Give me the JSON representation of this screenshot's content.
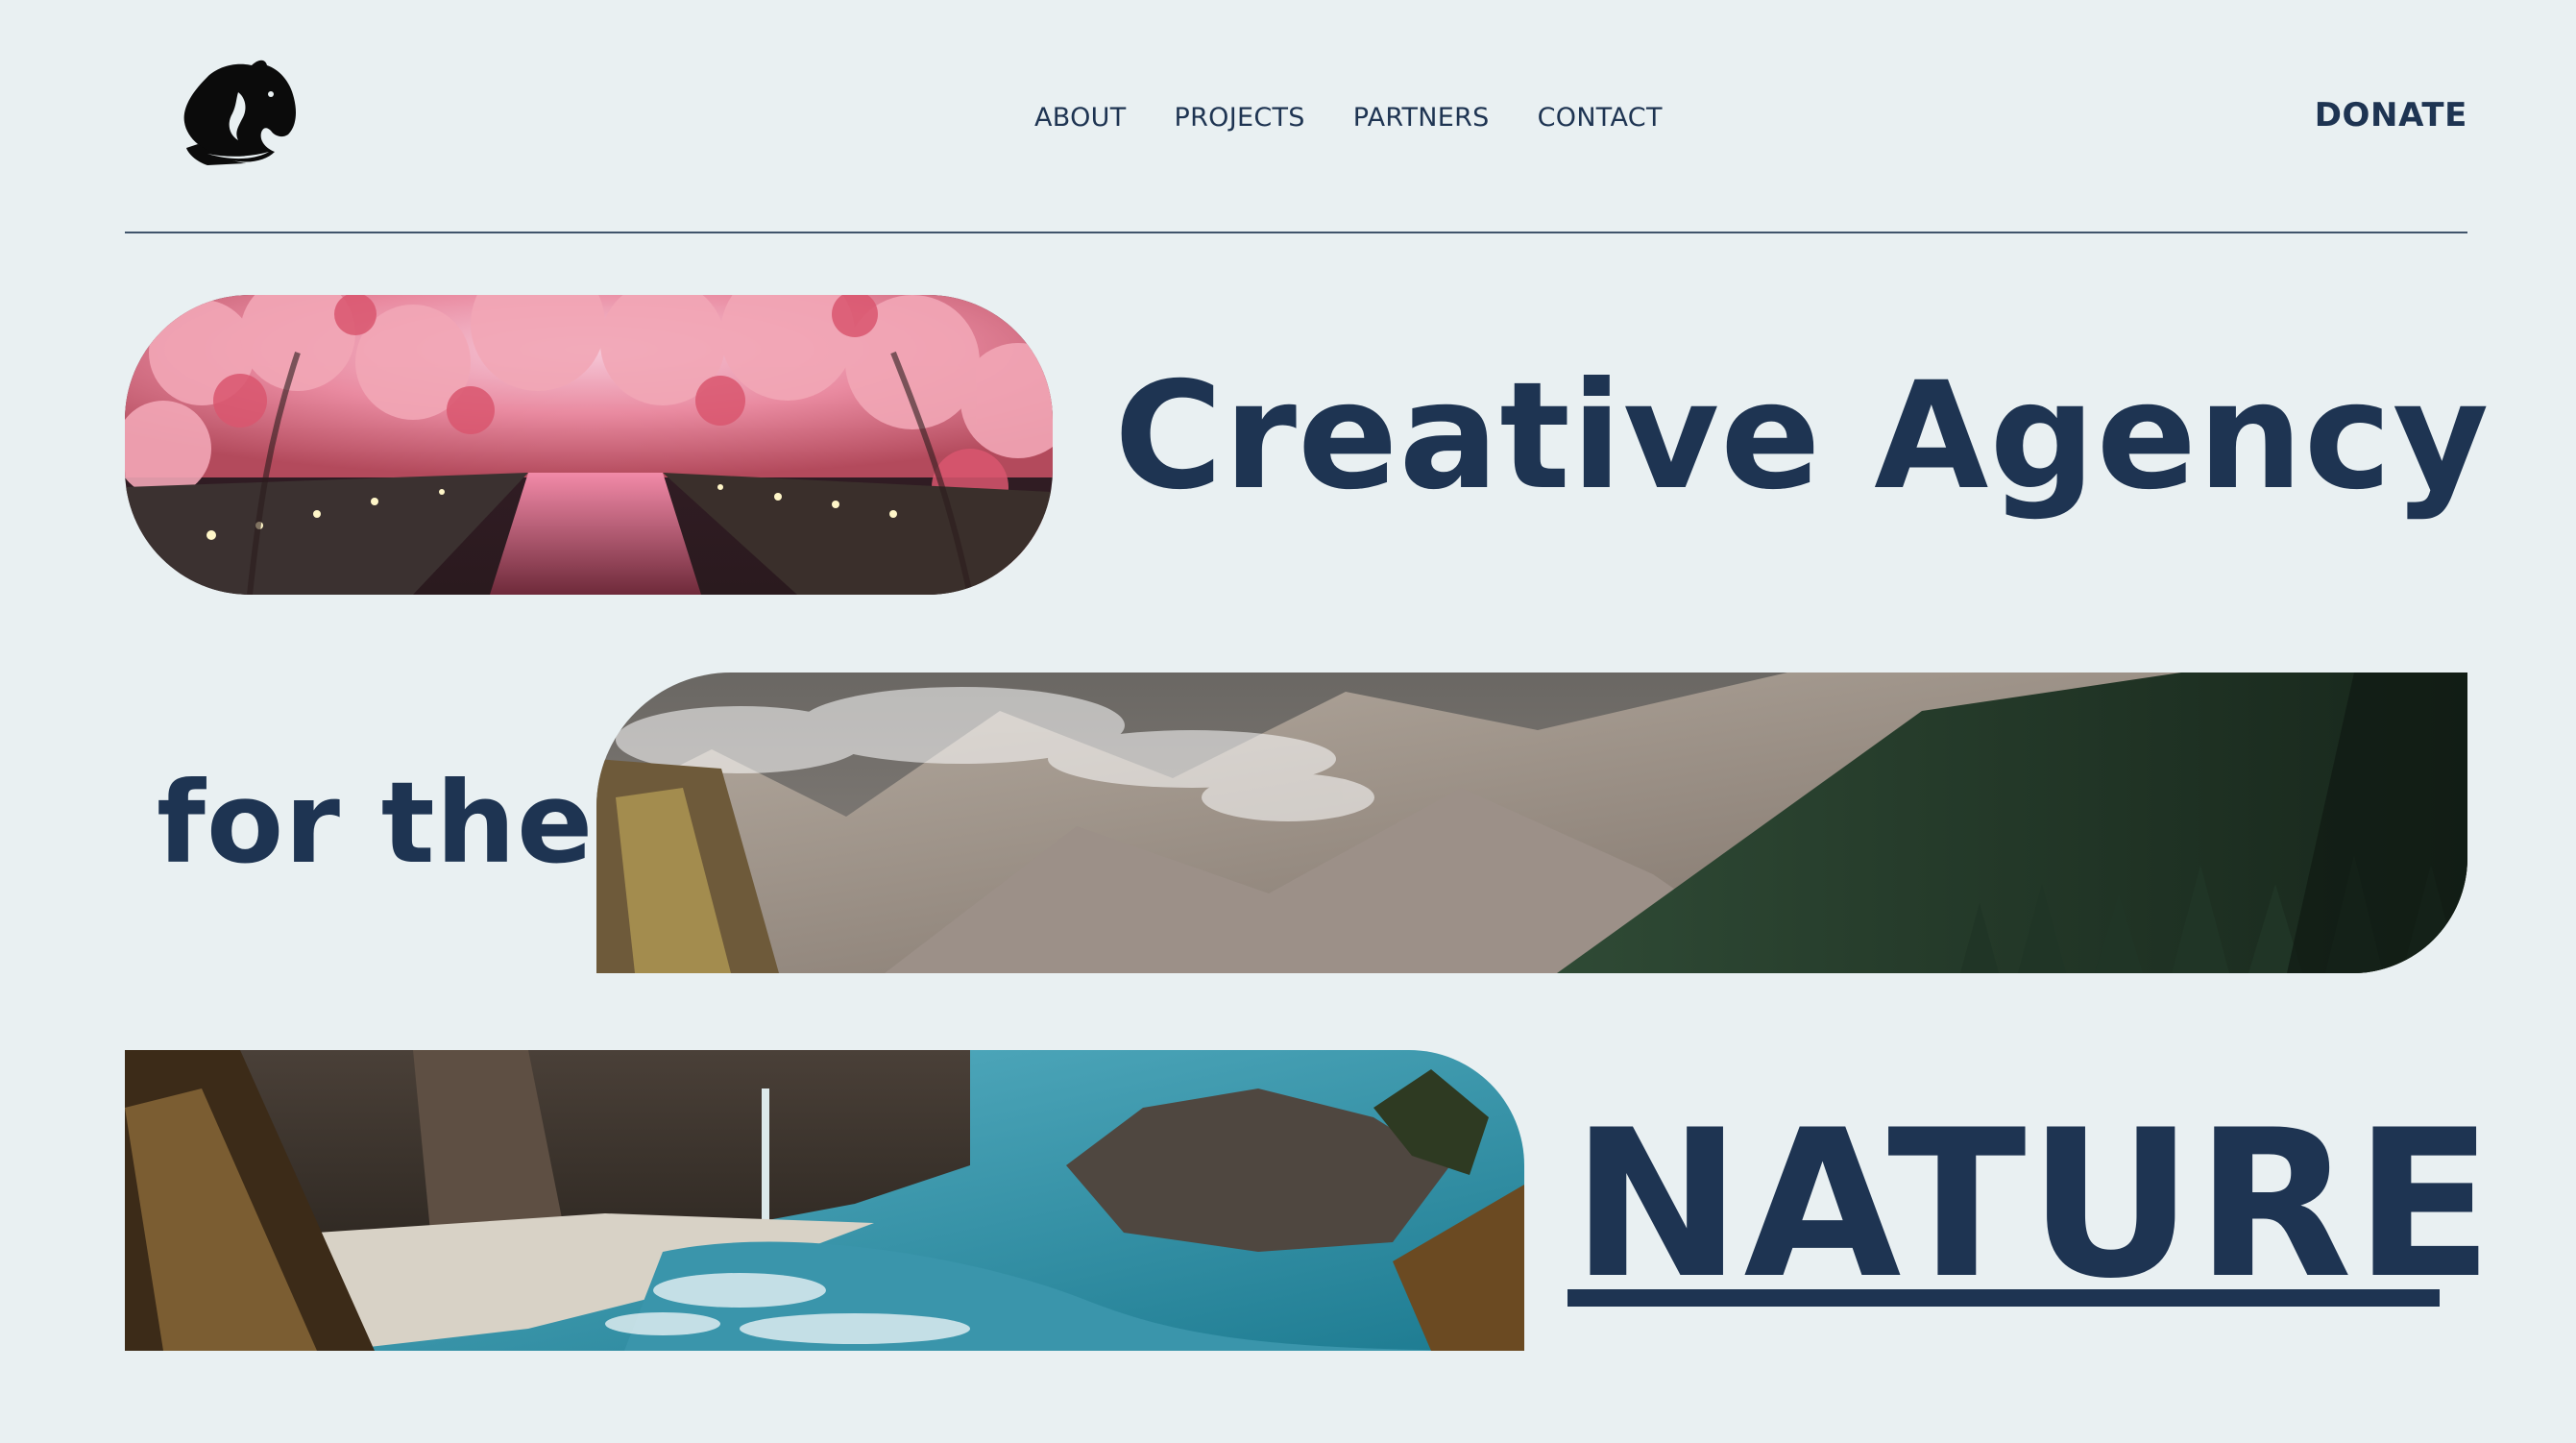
{
  "header": {
    "logo_icon": "horse-head-icon",
    "nav": [
      "ABOUT",
      "PROJECTS",
      "PARTNERS",
      "CONTACT"
    ],
    "donate_label": "DONATE"
  },
  "hero": {
    "line1": "Creative Agency",
    "line2": "for the",
    "line3": "NATURE"
  },
  "images": [
    {
      "subject": "cherry blossom canal at night"
    },
    {
      "subject": "misty mountains and pine forest"
    },
    {
      "subject": "coastal cove with waterfall and turquoise sea"
    }
  ],
  "colors": {
    "background": "#e9f0f2",
    "text": "#1e3452",
    "divider": "#40546b"
  }
}
